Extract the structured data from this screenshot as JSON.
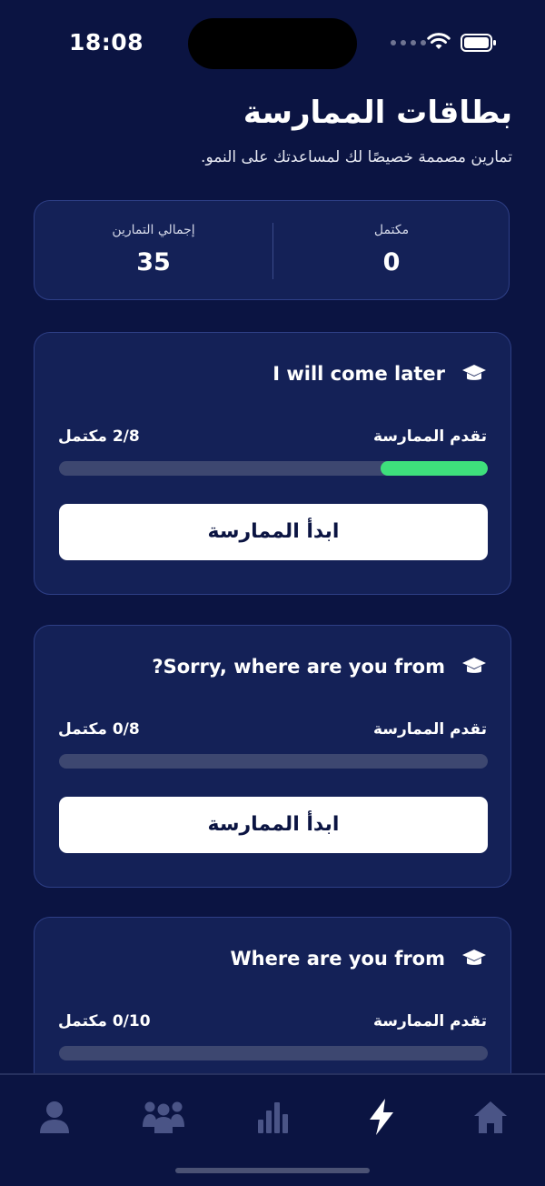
{
  "status_bar": {
    "time": "18:08"
  },
  "header": {
    "title": "بطاقات الممارسة",
    "subtitle": "تمارين مصممة خصيصًا لك لمساعدتك على النمو."
  },
  "stats": {
    "completed_label": "مكتمل",
    "completed_value": "0",
    "total_label": "إجمالي التمارين",
    "total_value": "35"
  },
  "cards": [
    {
      "title": "I will come later",
      "progress_label": "تقدم الممارسة",
      "progress_count": "2/8 مكتمل",
      "progress_fraction": 0.25,
      "button_label": "ابدأ الممارسة"
    },
    {
      "title": "Sorry, where are you from?",
      "progress_label": "تقدم الممارسة",
      "progress_count": "0/8 مكتمل",
      "progress_fraction": 0,
      "button_label": "ابدأ الممارسة"
    },
    {
      "title": "Where are you from",
      "progress_label": "تقدم الممارسة",
      "progress_count": "0/10 مكتمل",
      "progress_fraction": 0
    }
  ],
  "tabbar": {
    "items": [
      {
        "icon": "profile-icon",
        "active": false
      },
      {
        "icon": "community-icon",
        "active": false
      },
      {
        "icon": "stats-icon",
        "active": false
      },
      {
        "icon": "lightning-icon",
        "active": true
      },
      {
        "icon": "home-icon",
        "active": false
      }
    ]
  },
  "colors": {
    "background": "#0b1442",
    "card": "#142157",
    "progress_fill": "#3ee07c",
    "track": "#3d4770"
  }
}
